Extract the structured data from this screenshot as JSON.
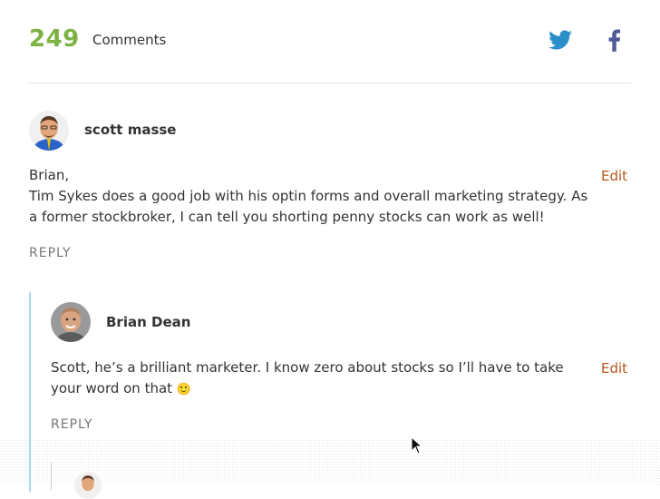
{
  "header": {
    "count": "249",
    "label": "Comments"
  },
  "colors": {
    "count": "#7cb342",
    "edit": "#b5561b",
    "twitter": "#2a8ec8",
    "facebook": "#4e5a9a",
    "thread_line": "#a8d8ea"
  },
  "icons": {
    "twitter": "twitter-icon",
    "facebook": "facebook-icon",
    "cursor": "mouse-cursor-icon"
  },
  "comments": [
    {
      "author": "scott masse",
      "lines": [
        "Brian,",
        "Tim Sykes does a good job with his optin forms and overall marketing strategy. As",
        "a former stockbroker, I can tell you shorting penny stocks can work as well!"
      ],
      "edit": "Edit",
      "reply": "REPLY"
    },
    {
      "author": "Brian Dean",
      "lines": [
        "Scott, he’s a brilliant marketer. I know zero about stocks so I’ll have to take",
        "your word on that"
      ],
      "emoji": "🙂",
      "edit": "Edit",
      "reply": "REPLY"
    }
  ]
}
